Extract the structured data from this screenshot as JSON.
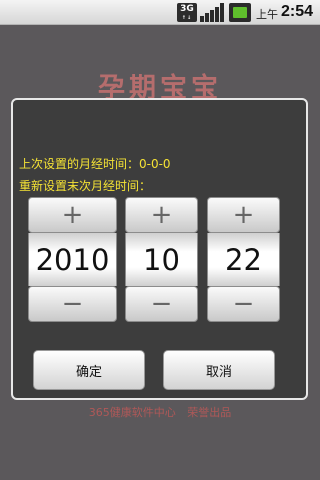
{
  "status_bar": {
    "network_badge": "3G",
    "network_sub": "↑↓",
    "am_pm": "上午",
    "time": "2:54",
    "icons": [
      "3g-icon",
      "signal-icon",
      "battery-icon"
    ]
  },
  "background": {
    "title": "孕期宝宝",
    "footer": "365健康软件中心 荣誉出品"
  },
  "dialog": {
    "last_setting_label": "上次设置的月经时间：0-0-0",
    "reset_label": "重新设置末次月经时间：",
    "increment_symbol": "+",
    "decrement_symbol": "−",
    "pickers": {
      "year": "2010",
      "month": "10",
      "day": "22"
    },
    "ok_label": "确定",
    "cancel_label": "取消"
  },
  "colors": {
    "accent_text": "#f4e235",
    "dialog_bg": "#3d3d3d"
  }
}
